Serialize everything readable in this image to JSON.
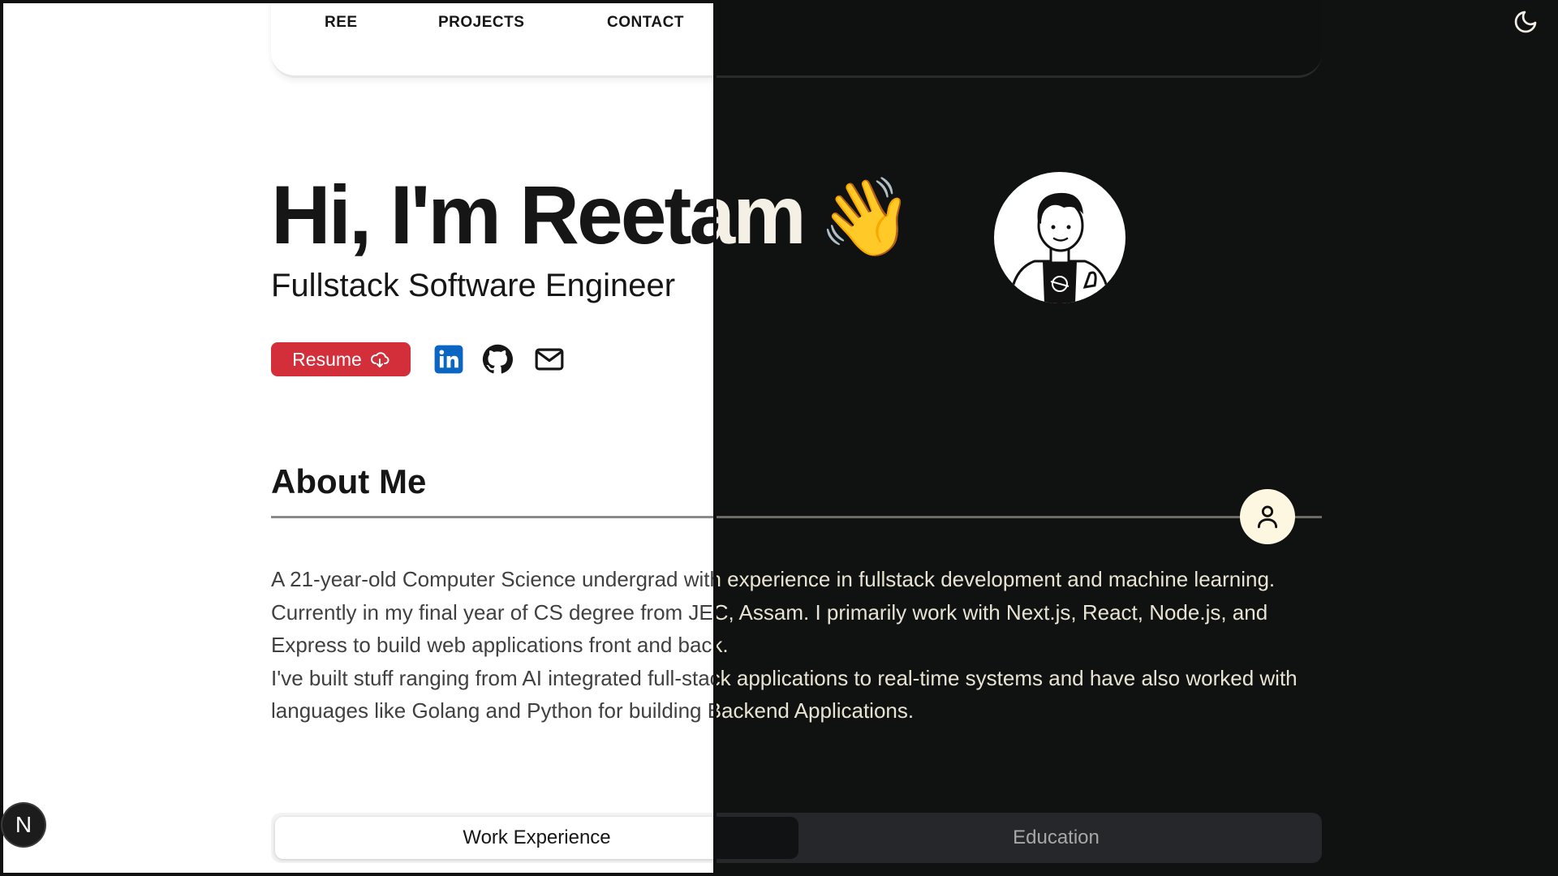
{
  "nav": {
    "items": [
      {
        "label": "REE"
      },
      {
        "label": "PROJECTS"
      },
      {
        "label": "CONTACT"
      }
    ],
    "theme_icon": "moon-icon"
  },
  "hero": {
    "greeting": "Hi, I'm Reetam",
    "wave_emoji": "👋",
    "subtitle": "Fullstack Software Engineer",
    "avatar_icon": "cartoon-avatar"
  },
  "actions": {
    "resume_label": "Resume",
    "resume_icon": "cloud-download-icon",
    "icons": [
      "linkedin-icon",
      "github-icon",
      "mail-icon"
    ]
  },
  "about": {
    "title": "About Me",
    "badge_icon": "user-icon",
    "paragraphs": [
      "A 21-year-old Computer Science undergrad with experience in fullstack development and machine learning. Currently in my final year of CS degree from JEC, Assam. I primarily work with Next.js, React, Node.js, and Express to build web applications front and back.",
      "I've built stuff ranging from AI integrated full-stack applications to real-time systems and have also worked with languages like Golang and Python for building Backend Applications."
    ]
  },
  "tabs": [
    {
      "label": "Work Experience"
    },
    {
      "label": "Education"
    }
  ],
  "dev_badge": {
    "label": "N"
  },
  "colors": {
    "accent_red": "#d32f3b",
    "linkedin_blue": "#0a66c2",
    "dark_bg": "#101111",
    "light_bg": "#ffffff",
    "dark_text": "#f5f0e6"
  }
}
